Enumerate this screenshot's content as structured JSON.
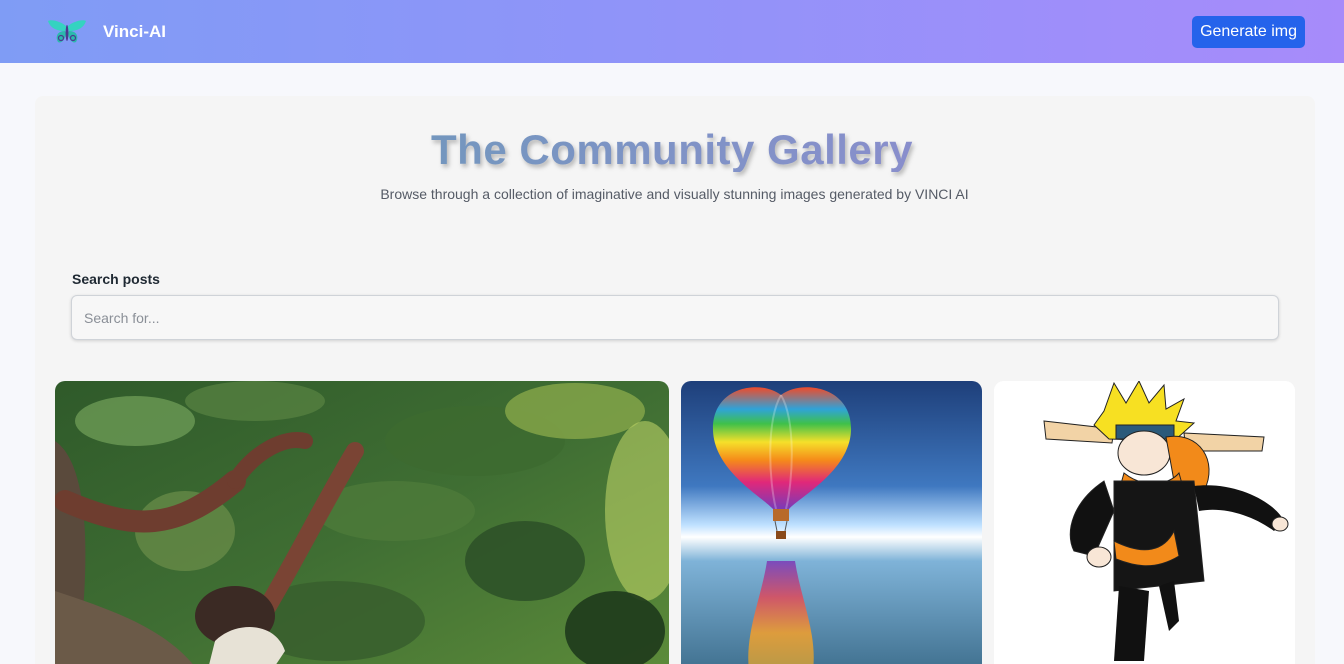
{
  "header": {
    "brand_name": "Vinci-AI",
    "generate_button": "Generate img",
    "logo_icon": "butterfly-icon"
  },
  "hero": {
    "title": "The Community Gallery",
    "subtitle": "Browse through a collection of imaginative and visually stunning images generated by VINCI AI"
  },
  "search": {
    "label": "Search posts",
    "placeholder": "Search for...",
    "value": ""
  },
  "gallery": {
    "cards": [
      {
        "image": "boy-climbing-tree-image"
      },
      {
        "image": "hot-air-balloon-image"
      },
      {
        "image": "anime-ninja-image"
      }
    ]
  },
  "colors": {
    "header_gradient_start": "#7f9cf5",
    "header_gradient_end": "#a78bfa",
    "primary_button": "#2563eb",
    "logo_teal": "#34d3c0"
  }
}
